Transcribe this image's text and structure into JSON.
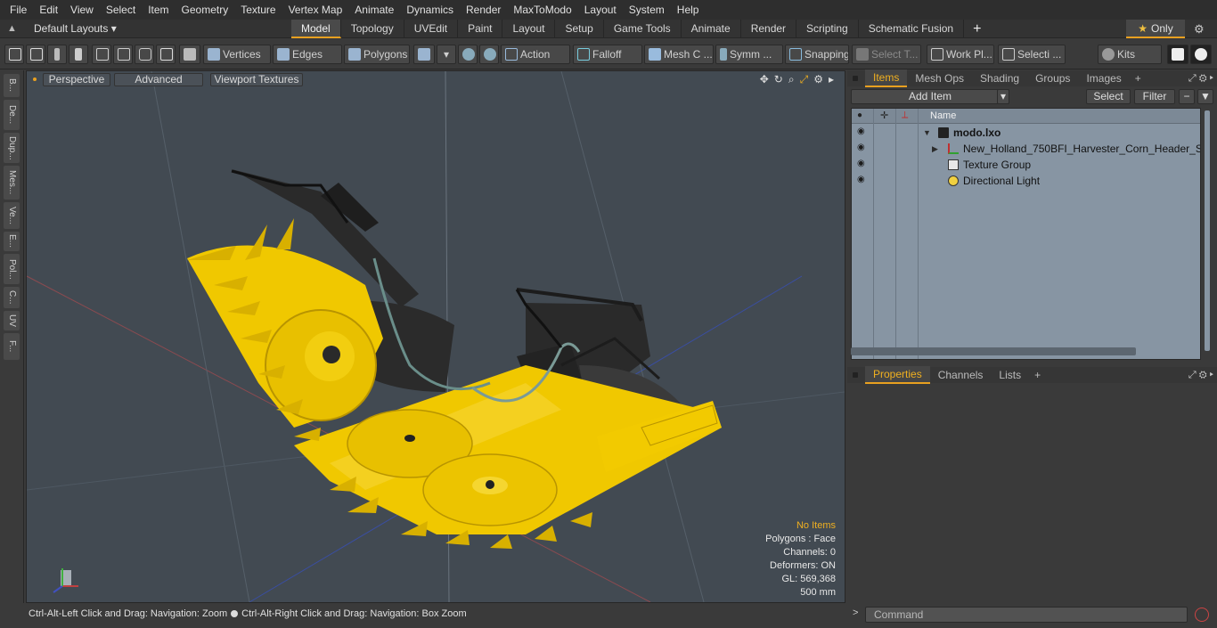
{
  "menu": [
    "File",
    "Edit",
    "View",
    "Select",
    "Item",
    "Geometry",
    "Texture",
    "Vertex Map",
    "Animate",
    "Dynamics",
    "Render",
    "MaxToModo",
    "Layout",
    "System",
    "Help"
  ],
  "layout_selector": "Default Layouts ▾",
  "tabs": [
    "Model",
    "Topology",
    "UVEdit",
    "Paint",
    "Layout",
    "Setup",
    "Game Tools",
    "Animate",
    "Render",
    "Scripting",
    "Schematic Fusion"
  ],
  "active_tab": "Model",
  "only_label": "Only",
  "toolbar": {
    "vertices": "Vertices",
    "edges": "Edges",
    "polygons": "Polygons",
    "action": "Action",
    "falloff": "Falloff",
    "mesh_c": "Mesh C ...",
    "symm": "Symm ...",
    "snapping": "Snapping",
    "select_t": "Select T...",
    "work_pl": "Work Pl...",
    "selecti": "Selecti ...",
    "kits": "Kits"
  },
  "left_tabs": [
    "B...",
    "De...",
    "Dup...",
    "Mes...",
    "Ve...",
    "E...",
    "Pol...",
    "C...",
    "UV",
    "F..."
  ],
  "viewport": {
    "perspective": "Perspective",
    "advanced": "Advanced",
    "textures": "Viewport Textures",
    "info": {
      "selection": "No Items",
      "polygons": "Polygons : Face",
      "channels": "Channels: 0",
      "deformers": "Deformers: ON",
      "gl": "GL: 569,368",
      "scale": "500 mm"
    },
    "colors": {
      "background": "#424a52",
      "model": "#f0c800",
      "dark_parts": "#262626"
    }
  },
  "status": {
    "left": "Ctrl-Alt-Left Click and Drag: Navigation: Zoom",
    "right": "Ctrl-Alt-Right Click and Drag: Navigation: Box Zoom"
  },
  "items_panel": {
    "tabs": [
      "Items",
      "Mesh Ops",
      "Shading",
      "Groups",
      "Images"
    ],
    "active_tab": "Items",
    "add_item": "Add Item",
    "select": "Select",
    "filter": "Filter",
    "column_name": "Name",
    "tree": [
      {
        "label": "modo.lxo",
        "icon": "scene-icon"
      },
      {
        "label": "New_Holland_750BFI_Harvester_Corn_Header_Se ...",
        "icon": "mesh-locator-icon"
      },
      {
        "label": "Texture Group",
        "icon": "texture-group-icon"
      },
      {
        "label": "Directional Light",
        "icon": "light-icon"
      }
    ]
  },
  "properties_panel": {
    "tabs": [
      "Properties",
      "Channels",
      "Lists"
    ],
    "active_tab": "Properties"
  },
  "command": {
    "placeholder": "Command"
  }
}
